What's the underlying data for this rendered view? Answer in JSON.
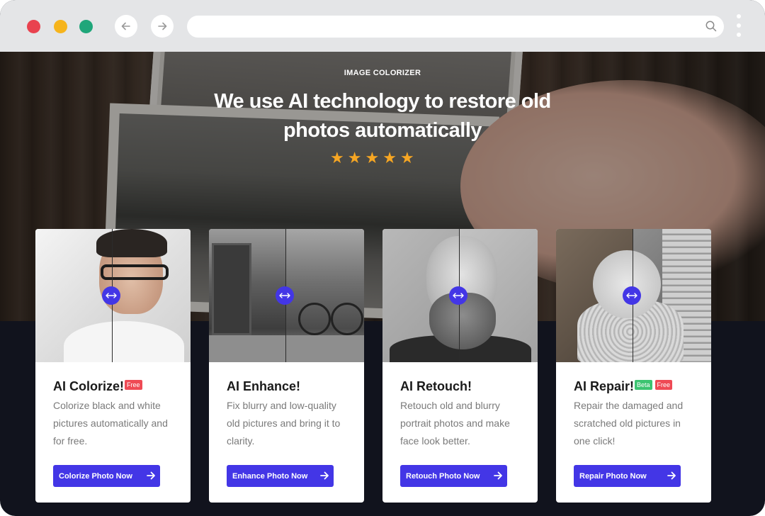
{
  "browser": {
    "colors": {
      "close": "#e9424f",
      "minimize": "#f6b41c",
      "maximize": "#1fa67a"
    },
    "url": ""
  },
  "hero": {
    "eyebrow": "IMAGE COLORIZER",
    "headline": "We use AI technology to restore old photos automatically",
    "rating_stars": 5,
    "star_color": "#f6a623"
  },
  "accent": "#4336e6",
  "cards": [
    {
      "title": "AI Colorize!",
      "badges": [
        "Free"
      ],
      "description": "Colorize black and white pictures automatically and for free.",
      "cta": "Colorize Photo Now"
    },
    {
      "title": "AI Enhance!",
      "badges": [],
      "description": "Fix blurry and low-quality old pictures and bring it to clarity.",
      "cta": "Enhance Photo Now"
    },
    {
      "title": "AI Retouch!",
      "badges": [],
      "description": "Retouch old and blurry portrait photos and make face look better.",
      "cta": "Retouch Photo Now"
    },
    {
      "title": "AI Repair!",
      "badges": [
        "Beta",
        "Free"
      ],
      "description": "Repair the damaged and scratched old pictures in one click!",
      "cta": "Repair Photo Now"
    }
  ]
}
